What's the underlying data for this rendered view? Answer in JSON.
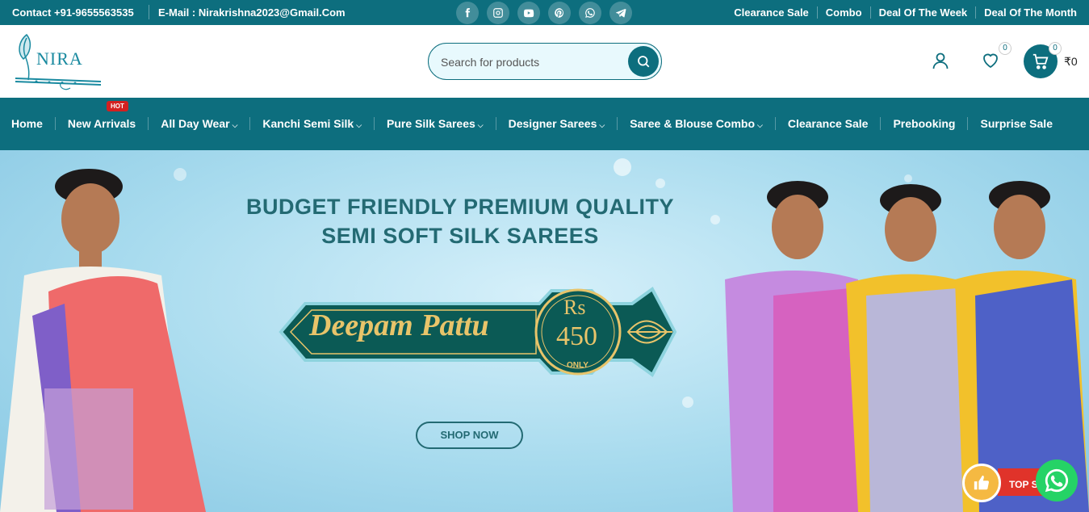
{
  "topbar": {
    "contact": "Contact +91-9655563535",
    "email": "E-Mail : Nirakrishna2023@Gmail.Com",
    "social_icons": [
      "facebook-icon",
      "instagram-icon",
      "youtube-icon",
      "pinterest-icon",
      "whatsapp-icon",
      "telegram-icon"
    ],
    "links": [
      "Clearance Sale",
      "Combo",
      "Deal Of The Week",
      "Deal Of The Month"
    ]
  },
  "header": {
    "logo_text": "NIRA",
    "search_placeholder": "Search for products",
    "wishlist_count": "0",
    "cart_count": "0",
    "cart_total": "₹0"
  },
  "nav": {
    "hot_badge": "HOT",
    "items": [
      {
        "label": "Home",
        "dropdown": false
      },
      {
        "label": "New Arrivals",
        "dropdown": false
      },
      {
        "label": "All Day Wear",
        "dropdown": true
      },
      {
        "label": "Kanchi Semi Silk",
        "dropdown": true
      },
      {
        "label": "Pure Silk Sarees",
        "dropdown": true
      },
      {
        "label": "Designer Sarees",
        "dropdown": true
      },
      {
        "label": "Saree & Blouse Combo",
        "dropdown": true
      },
      {
        "label": "Clearance Sale",
        "dropdown": false
      },
      {
        "label": "Prebooking",
        "dropdown": false
      },
      {
        "label": "Surprise Sale",
        "dropdown": false
      }
    ]
  },
  "hero": {
    "headline_1": "BUDGET FRIENDLY PREMIUM QUALITY",
    "headline_2": "SEMI SOFT SILK SAREES",
    "product_name": "Deepam Pattu",
    "price_currency": "Rs",
    "price_value": "450",
    "price_note": "ONLY",
    "cta": "SHOP NOW"
  },
  "widgets": {
    "top_seller_text": "TOP S"
  },
  "colors": {
    "brand_teal": "#0d6e7e",
    "hero_text": "#236a73",
    "label_green": "#0b5a55",
    "gold": "#e8c46a",
    "hot_red": "#d32020",
    "whatsapp_green": "#25d366"
  }
}
